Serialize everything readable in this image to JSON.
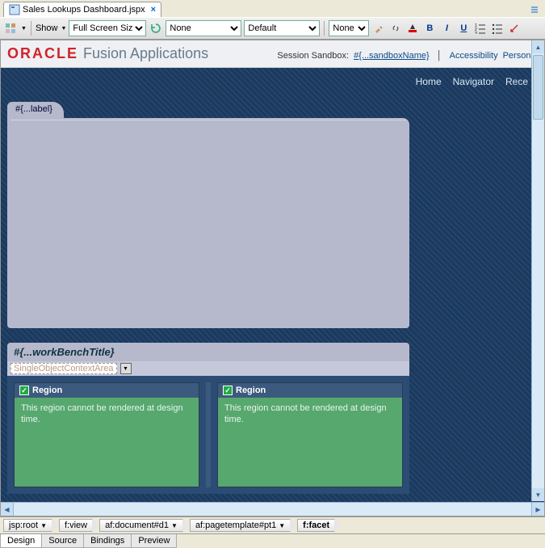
{
  "editor_tab": {
    "filename": "Sales Lookups Dashboard.jspx",
    "close": "×"
  },
  "toolbar": {
    "show_label": "Show",
    "view_mode": "Full Screen Size",
    "sel_none1": "None",
    "sel_default": "Default",
    "sel_none2": "None",
    "bold": "B",
    "italic": "I",
    "underline": "U"
  },
  "header": {
    "oracle": "ORACLE",
    "fusion": "Fusion Applications",
    "session_label": "Session Sandbox:",
    "session_value": "#{...sandboxName}",
    "link_accessibility": "Accessibility",
    "link_personal": "Personal"
  },
  "nav": {
    "home": "Home",
    "navigator": "Navigator",
    "rece": "Rece"
  },
  "folder": {
    "tab_label": "#{...label}"
  },
  "workbench": {
    "title": "#{...workBenchTitle}",
    "soc_label": "SingleObjectContextArea",
    "region1": {
      "title": "Region",
      "msg": "This region cannot be rendered at design time."
    },
    "region2": {
      "title": "Region",
      "msg": "This region cannot be rendered at design time."
    }
  },
  "breadcrumb": {
    "items": [
      "jsp:root",
      "f:view",
      "af:document#d1",
      "af:pagetemplate#pt1",
      "f:facet"
    ]
  },
  "bottom_tabs": {
    "design": "Design",
    "source": "Source",
    "bindings": "Bindings",
    "preview": "Preview"
  }
}
